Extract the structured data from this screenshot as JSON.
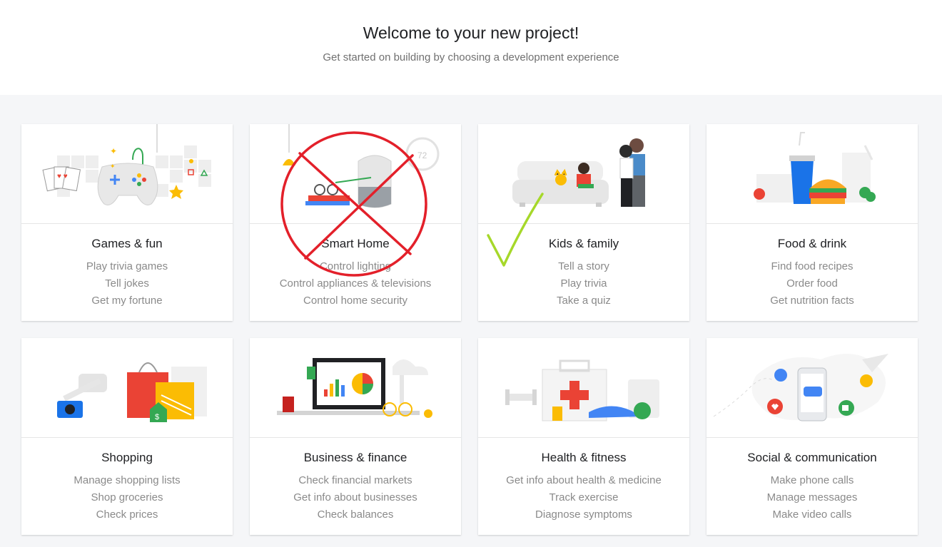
{
  "header": {
    "title": "Welcome to your new project!",
    "subtitle": "Get started on building by choosing a development experience"
  },
  "cards": [
    {
      "title": "Games & fun",
      "examples": [
        "Play trivia games",
        "Tell jokes",
        "Get my fortune"
      ],
      "illustration": "game-controller-icon"
    },
    {
      "title": "Smart Home",
      "examples": [
        "Control lighting",
        "Control appliances & televisions",
        "Control home security"
      ],
      "illustration": "smart-speaker-icon"
    },
    {
      "title": "Kids & family",
      "examples": [
        "Tell a story",
        "Play trivia",
        "Take a quiz"
      ],
      "illustration": "family-couch-icon"
    },
    {
      "title": "Food & drink",
      "examples": [
        "Find food recipes",
        "Order food",
        "Get nutrition facts"
      ],
      "illustration": "burger-drink-icon"
    },
    {
      "title": "Shopping",
      "examples": [
        "Manage shopping lists",
        "Shop groceries",
        "Check prices"
      ],
      "illustration": "shopping-bags-icon"
    },
    {
      "title": "Business & finance",
      "examples": [
        "Check financial markets",
        "Get info about businesses",
        "Check balances"
      ],
      "illustration": "laptop-chart-icon"
    },
    {
      "title": "Health & fitness",
      "examples": [
        "Get info about health & medicine",
        "Track exercise",
        "Diagnose symptoms"
      ],
      "illustration": "first-aid-kit-icon"
    },
    {
      "title": "Social & communication",
      "examples": [
        "Make phone calls",
        "Manage messages",
        "Make video calls"
      ],
      "illustration": "phone-messages-icon"
    }
  ],
  "annotations": {
    "cross_color": "#e3202a",
    "check_color": "#a6d82a",
    "crossed_card": "Smart Home",
    "checked_card": "Kids & family"
  }
}
